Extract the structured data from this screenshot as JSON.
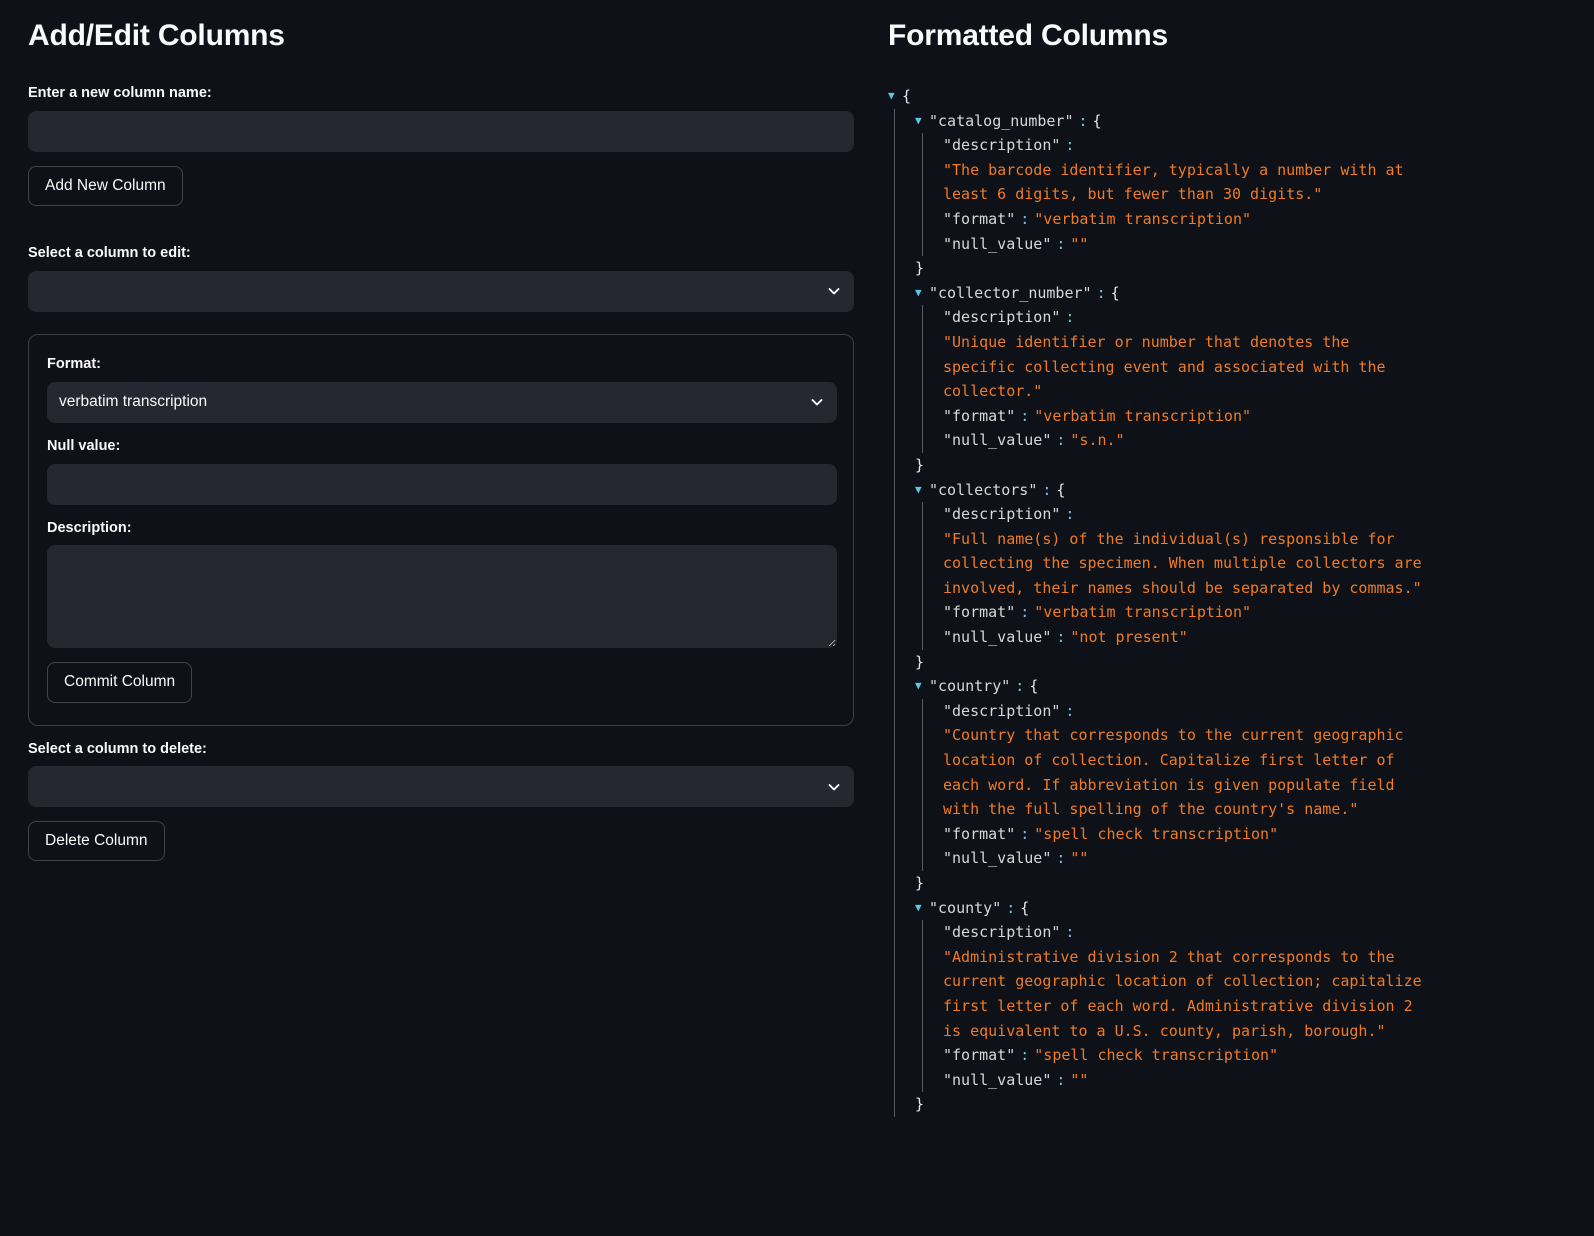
{
  "left": {
    "title": "Add/Edit Columns",
    "new_column_label": "Enter a new column name:",
    "new_column_value": "",
    "new_column_placeholder": "",
    "add_button": "Add New Column",
    "select_edit_label": "Select a column to edit:",
    "select_edit_value": "",
    "edit_form": {
      "format_label": "Format:",
      "format_value": "verbatim transcription",
      "null_value_label": "Null value:",
      "null_value_value": "",
      "description_label": "Description:",
      "description_value": "",
      "commit_button": "Commit Column"
    },
    "select_delete_label": "Select a column to delete:",
    "select_delete_value": "",
    "delete_button": "Delete Column"
  },
  "right": {
    "title": "Formatted Columns",
    "json": {
      "open_brace": "{",
      "close_brace": "}",
      "colon": ":",
      "triangle": "▼",
      "keys": {
        "description": "\"description\"",
        "format": "\"format\"",
        "null_value": "\"null_value\""
      },
      "entries": [
        {
          "key": "\"catalog_number\"",
          "description": "\"The barcode identifier, typically a number with at least 6 digits, but fewer than 30 digits.\"",
          "format": "\"verbatim transcription\"",
          "null_value": "\"\""
        },
        {
          "key": "\"collector_number\"",
          "description": "\"Unique identifier or number that denotes the specific collecting event and associated with the collector.\"",
          "format": "\"verbatim transcription\"",
          "null_value": "\"s.n.\""
        },
        {
          "key": "\"collectors\"",
          "description": "\"Full name(s) of the individual(s) responsible for collecting the specimen. When multiple collectors are involved, their names should be separated by commas.\"",
          "format": "\"verbatim transcription\"",
          "null_value": "\"not present\""
        },
        {
          "key": "\"country\"",
          "description": "\"Country that corresponds to the current geographic location of collection. Capitalize first letter of each word. If abbreviation is given populate field with the full spelling of the country's name.\"",
          "format": "\"spell check transcription\"",
          "null_value": "\"\""
        },
        {
          "key": "\"county\"",
          "description": "\"Administrative division 2 that corresponds to the current geographic location of collection; capitalize first letter of each word. Administrative division 2 is equivalent to a U.S. county, parish, borough.\"",
          "format": "\"spell check transcription\"",
          "null_value": "\"\""
        }
      ]
    }
  },
  "icons": {
    "chevron_down": "chevron-down-icon",
    "collapse_triangle": "triangle-down-icon"
  },
  "colors": {
    "background": "#0e1117",
    "widget_background": "#262730",
    "text": "#fafafa",
    "json_key": "#d8d8d8",
    "json_value": "#ef7c24",
    "json_triangle": "#5bc8e8",
    "border": "#41444c"
  }
}
